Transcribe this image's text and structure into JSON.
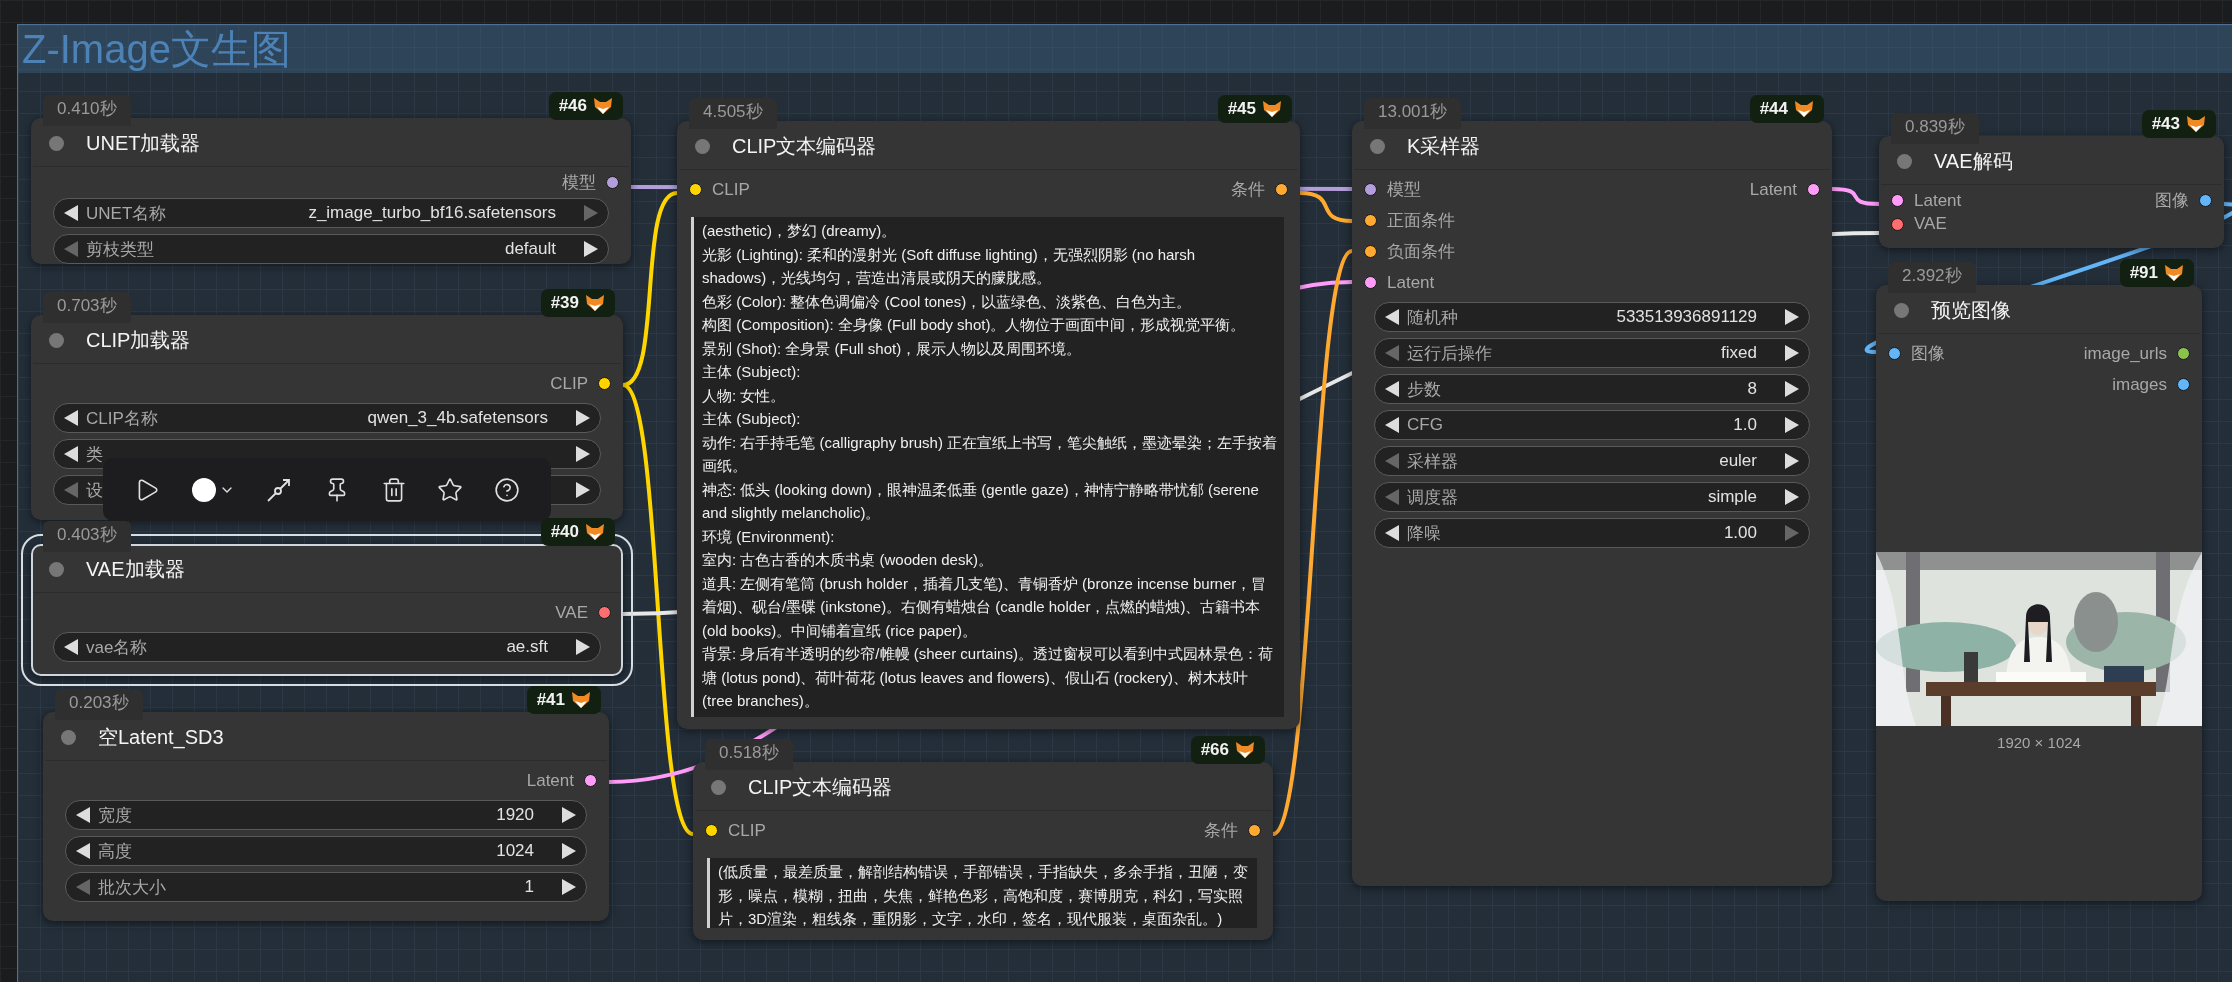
{
  "group": {
    "title": "Z-Image文生图"
  },
  "nodes": [
    {
      "kind": "widgets",
      "time": "0.410秒",
      "badge": "#46",
      "title": "UNET加载器",
      "selected": false,
      "outputs": [
        {
          "label": "模型",
          "color": "#b39ddb"
        }
      ],
      "widgets": [
        {
          "label": "UNET名称",
          "value": "z_image_turbo_bf16.safetensors",
          "prev_enabled": true,
          "next_enabled": false
        },
        {
          "label": "剪枝类型",
          "value": "default",
          "prev_enabled": false,
          "next_enabled": true
        }
      ]
    },
    {
      "kind": "widgets",
      "time": "0.703秒",
      "badge": "#39",
      "title": "CLIP加载器",
      "selected": false,
      "outputs": [
        {
          "label": "CLIP",
          "color": "#ffd500"
        }
      ],
      "widgets": [
        {
          "label": "CLIP名称",
          "value": "qwen_3_4b.safetensors",
          "prev_enabled": true,
          "next_enabled": true
        },
        {
          "label": "类",
          "prev_enabled": true,
          "next_enabled": true
        },
        {
          "label": "设",
          "prev_enabled": false,
          "next_enabled": true
        }
      ]
    },
    {
      "kind": "widgets",
      "time": "0.403秒",
      "badge": "#40",
      "title": "VAE加载器",
      "selected": true,
      "outputs": [
        {
          "label": "VAE",
          "color": "#ff6e6e"
        }
      ],
      "widgets": [
        {
          "label": "vae名称",
          "value": "ae.sft",
          "prev_enabled": true,
          "next_enabled": true
        }
      ]
    },
    {
      "kind": "widgets",
      "time": "0.203秒",
      "badge": "#41",
      "title": "空Latent_SD3",
      "selected": false,
      "outputs": [
        {
          "label": "Latent",
          "color": "#ff9cf9"
        }
      ],
      "widgets": [
        {
          "label": "宽度",
          "value": "1920",
          "prev_enabled": true,
          "next_enabled": true
        },
        {
          "label": "高度",
          "value": "1024",
          "prev_enabled": true,
          "next_enabled": true
        },
        {
          "label": "批次大小",
          "value": "1",
          "prev_enabled": false,
          "next_enabled": true
        }
      ]
    },
    {
      "kind": "text",
      "time": "4.505秒",
      "badge": "#45",
      "title": "CLIP文本编码器",
      "selected": false,
      "inputs": [
        {
          "label": "CLIP",
          "color": "#ffd500"
        }
      ],
      "outputs": [
        {
          "label": "条件",
          "color": "#ffa931"
        }
      ],
      "prompt": [
        "(aesthetic)，梦幻 (dreamy)。",
        "光影 (Lighting): 柔和的漫射光 (Soft diffuse lighting)，无强烈阴影 (no harsh shadows)，光线均匀，营造出清晨或阴天的朦胧感。",
        "色彩 (Color): 整体色调偏冷 (Cool tones)，以蓝绿色、淡紫色、白色为主。",
        "构图 (Composition): 全身像 (Full body shot)。人物位于画面中间，形成视觉平衡。",
        "景别 (Shot): 全身景 (Full shot)，展示人物以及周围环境。",
        "主体 (Subject):",
        "人物: 女性。",
        "主体 (Subject):",
        "动作: 右手持毛笔 (calligraphy brush) 正在宣纸上书写，笔尖触纸，墨迹晕染；左手按着画纸。",
        "神态: 低头 (looking down)，眼神温柔低垂 (gentle gaze)，神情宁静略带忧郁 (serene and slightly melancholic)。",
        "环境 (Environment):",
        "室内: 古色古香的木质书桌 (wooden desk)。",
        "道具: 左侧有笔筒 (brush holder，插着几支笔)、青铜香炉 (bronze incense burner，冒着烟)、砚台/墨碟 (inkstone)。右侧有蜡烛台 (candle holder，点燃的蜡烛)、古籍书本 (old books)。中间铺着宣纸 (rice paper)。",
        "背景: 身后有半透明的纱帘/帷幔 (sheer curtains)。透过窗棂可以看到中式园林景色：荷塘 (lotus pond)、荷叶荷花 (lotus leaves and flowers)、假山石 (rockery)、树木枝叶 (tree branches)。"
      ]
    },
    {
      "kind": "text",
      "time": "0.518秒",
      "badge": "#66",
      "title": "CLIP文本编码器",
      "selected": false,
      "inputs": [
        {
          "label": "CLIP",
          "color": "#ffd500"
        }
      ],
      "outputs": [
        {
          "label": "条件",
          "color": "#ffa931"
        }
      ],
      "prompt": [
        "(低质量，最差质量，解剖结构错误，手部错误，手指缺失，多余手指，丑陋，变形，噪点，模糊，扭曲，失焦，鲜艳色彩，高饱和度，赛博朋克，科幻，写实照片，3D渲染，粗线条，重阴影，文字，水印，签名，现代服装，桌面杂乱。)"
      ]
    },
    {
      "kind": "widgets",
      "time": "13.001秒",
      "badge": "#44",
      "title": "K采样器",
      "selected": false,
      "inputs": [
        {
          "label": "模型",
          "color": "#b39ddb"
        },
        {
          "label": "正面条件",
          "color": "#ffa931"
        },
        {
          "label": "负面条件",
          "color": "#ffa931"
        },
        {
          "label": "Latent",
          "color": "#ff9cf9"
        }
      ],
      "outputs": [
        {
          "label": "Latent",
          "color": "#ff9cf9"
        }
      ],
      "widgets": [
        {
          "label": "随机种",
          "value": "533513936891129",
          "prev_enabled": true,
          "next_enabled": true
        },
        {
          "label": "运行后操作",
          "value": "fixed",
          "prev_enabled": false,
          "next_enabled": true
        },
        {
          "label": "步数",
          "value": "8",
          "prev_enabled": true,
          "next_enabled": true
        },
        {
          "label": "CFG",
          "value": "1.0",
          "prev_enabled": true,
          "next_enabled": true
        },
        {
          "label": "采样器",
          "value": "euler",
          "prev_enabled": false,
          "next_enabled": true
        },
        {
          "label": "调度器",
          "value": "simple",
          "prev_enabled": false,
          "next_enabled": true
        },
        {
          "label": "降噪",
          "value": "1.00",
          "prev_enabled": true,
          "next_enabled": false
        }
      ]
    },
    {
      "kind": "widgets",
      "time": "0.839秒",
      "badge": "#43",
      "title": "VAE解码",
      "selected": false,
      "inputs": [
        {
          "label": "Latent",
          "color": "#ff9cf9"
        },
        {
          "label": "VAE",
          "color": "#ff6e6e"
        }
      ],
      "outputs": [
        {
          "label": "图像",
          "color": "#64b5f6"
        }
      ]
    },
    {
      "kind": "preview",
      "time": "2.392秒",
      "badge": "#91",
      "title": "预览图像",
      "selected": false,
      "inputs": [
        {
          "label": "图像",
          "color": "#64b5f6"
        }
      ],
      "outputs": [
        {
          "label": "image_urls",
          "color": "#8bc34a"
        },
        {
          "label": "images",
          "color": "#64b5f6"
        }
      ],
      "caption": "1920 × 1024"
    }
  ]
}
